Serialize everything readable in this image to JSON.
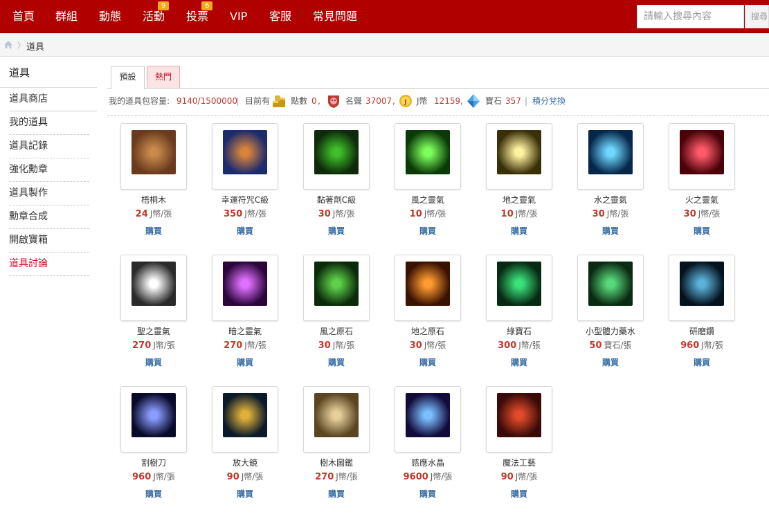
{
  "nav": {
    "items": [
      {
        "label": "首頁"
      },
      {
        "label": "群組"
      },
      {
        "label": "動態"
      },
      {
        "label": "活動",
        "badge": "9"
      },
      {
        "label": "投票",
        "badge": "6"
      },
      {
        "label": "VIP"
      },
      {
        "label": "客服"
      },
      {
        "label": "常見問題"
      }
    ],
    "search_placeholder": "請輸入搜尋內容",
    "search_button": "搜尋"
  },
  "breadcrumb": {
    "separator": "〉",
    "current": "道具"
  },
  "sidebar": {
    "title": "道具",
    "items": [
      {
        "label": "道具商店"
      },
      {
        "label": "我的道具"
      },
      {
        "label": "道具記錄"
      },
      {
        "label": "強化勳章"
      },
      {
        "label": "道具製作"
      },
      {
        "label": "勳章合成"
      },
      {
        "label": "開啟寶箱"
      },
      {
        "label": "道具討論"
      }
    ]
  },
  "tabs": {
    "default": "預設",
    "hot": "熱門"
  },
  "info": {
    "capacity_label": "我的道具包容量:",
    "capacity_value": "9140/1500000",
    "owned_label": "目前有",
    "points_label": "點數",
    "points_value": "0",
    "fame_label": "名聲",
    "fame_value": "37007",
    "coin_label": "J幣",
    "coin_value": "12159",
    "gem_label": "寶石",
    "gem_value": "357",
    "exchange_link": "積分兌換",
    "pipe": "|",
    "comma": ","
  },
  "unit_coin": "J幣/張",
  "unit_gem": "寶石/張",
  "buy_label": "購買",
  "colors": {
    "nav_bg": "#b00000",
    "price": "#c0392b",
    "link": "#3a6ea5",
    "badge": "#f0a81c"
  },
  "items": [
    {
      "name": "梧桐木",
      "price": "24",
      "unit": "J幣/張",
      "icon": "wood-icon"
    },
    {
      "name": "幸運符咒C級",
      "price": "350",
      "unit": "J幣/張",
      "icon": "talisman-icon"
    },
    {
      "name": "黏著劑C級",
      "price": "30",
      "unit": "J幣/張",
      "icon": "potion-bottle-icon"
    },
    {
      "name": "風之靈氣",
      "price": "10",
      "unit": "J幣/張",
      "icon": "wind-aura-icon"
    },
    {
      "name": "地之靈氣",
      "price": "10",
      "unit": "J幣/張",
      "icon": "earth-aura-icon"
    },
    {
      "name": "水之靈氣",
      "price": "30",
      "unit": "J幣/張",
      "icon": "water-aura-icon"
    },
    {
      "name": "火之靈氣",
      "price": "30",
      "unit": "J幣/張",
      "icon": "fire-aura-icon"
    },
    {
      "name": "聖之靈氣",
      "price": "270",
      "unit": "J幣/張",
      "icon": "holy-aura-icon"
    },
    {
      "name": "暗之靈氣",
      "price": "270",
      "unit": "J幣/張",
      "icon": "dark-aura-icon"
    },
    {
      "name": "風之原石",
      "price": "30",
      "unit": "J幣/張",
      "icon": "wind-ore-icon"
    },
    {
      "name": "地之原石",
      "price": "30",
      "unit": "J幣/張",
      "icon": "earth-ore-icon"
    },
    {
      "name": "綠寶石",
      "price": "300",
      "unit": "J幣/張",
      "icon": "emerald-icon"
    },
    {
      "name": "小型體力藥水",
      "price": "50",
      "unit": "寶石/張",
      "icon": "vial-icon"
    },
    {
      "name": "研磨鑽",
      "price": "960",
      "unit": "J幣/張",
      "icon": "drill-icon"
    },
    {
      "name": "割樹刀",
      "price": "960",
      "unit": "J幣/張",
      "icon": "knife-icon"
    },
    {
      "name": "放大鏡",
      "price": "90",
      "unit": "J幣/張",
      "icon": "spyglass-icon"
    },
    {
      "name": "樹木圖鑑",
      "price": "270",
      "unit": "J幣/張",
      "icon": "map-icon"
    },
    {
      "name": "感應水晶",
      "price": "9600",
      "unit": "J幣/張",
      "icon": "crystal-icon"
    },
    {
      "name": "魔法工藝",
      "price": "90",
      "unit": "J幣/張",
      "icon": "spellbook-icon"
    }
  ]
}
